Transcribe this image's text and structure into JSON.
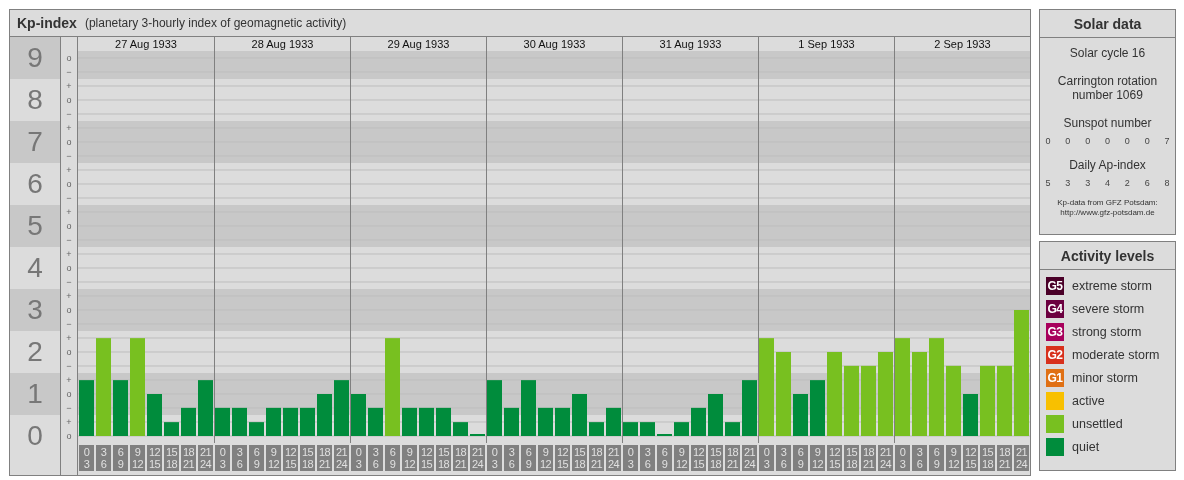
{
  "kp_panel": {
    "title": "Kp-index",
    "subtitle": "(planetary 3-hourly index of geomagnetic activity)",
    "scale": [
      {
        "marks": [
          "o",
          "−"
        ]
      },
      {
        "marks": [
          "+",
          "o",
          "−"
        ]
      },
      {
        "marks": [
          "+",
          "o",
          "−"
        ]
      },
      {
        "marks": [
          "+",
          "o",
          "−"
        ]
      },
      {
        "marks": [
          "+",
          "o",
          "−"
        ]
      },
      {
        "marks": [
          "+",
          "o",
          "−"
        ]
      },
      {
        "marks": [
          "+",
          "o",
          "−"
        ]
      },
      {
        "marks": [
          "+",
          "o",
          "−"
        ]
      },
      {
        "marks": [
          "+",
          "o",
          "−"
        ]
      },
      {
        "marks": [
          "+",
          "o"
        ]
      }
    ],
    "days": [
      {
        "date": "27 Aug 1933"
      },
      {
        "date": "28 Aug 1933"
      },
      {
        "date": "29 Aug 1933"
      },
      {
        "date": "30 Aug 1933"
      },
      {
        "date": "31 Aug 1933"
      },
      {
        "date": "1 Sep 1933"
      },
      {
        "date": "2 Sep 1933"
      }
    ],
    "chart_data": {
      "type": "bar",
      "stacked": true,
      "grid": true,
      "ylim": [
        0,
        9
      ],
      "yticks": [
        9,
        8,
        7,
        6,
        5,
        4,
        3,
        2,
        1,
        0
      ],
      "categories": [
        "0 3",
        "3 6",
        "6 9",
        "9 12",
        "12 15",
        "15 18",
        "18 21",
        "21 24",
        "0 3",
        "3 6",
        "6 9",
        "9 12",
        "12 15",
        "15 18",
        "18 21",
        "21 24",
        "0 3",
        "3 6",
        "6 9",
        "9 12",
        "12 15",
        "15 18",
        "18 21",
        "21 24",
        "0 3",
        "3 6",
        "6 9",
        "9 12",
        "12 15",
        "15 18",
        "18 21",
        "21 24",
        "0 3",
        "3 6",
        "6 9",
        "9 12",
        "12 15",
        "15 18",
        "18 21",
        "21 24",
        "0 3",
        "3 6",
        "6 9",
        "9 12",
        "12 15",
        "15 18",
        "18 21",
        "21 24",
        "0 3",
        "3 6",
        "6 9",
        "9 12",
        "12 15",
        "15 18",
        "18 21",
        "21 24"
      ],
      "series": [
        {
          "color": "#008c3c",
          "values": [
            1.33,
            null,
            1.33,
            null,
            1,
            0.33,
            0.67,
            1.33,
            0.67,
            0.67,
            0.33,
            0.67,
            0.67,
            0.67,
            1,
            1.33,
            1,
            0.67,
            null,
            0.67,
            0.67,
            0.67,
            0.33,
            0,
            1.33,
            0.67,
            1.33,
            0.67,
            0.67,
            1,
            0.33,
            0.67,
            0.33,
            0.33,
            0,
            0.33,
            0.67,
            1,
            0.33,
            1.33,
            null,
            null,
            1,
            1.33,
            null,
            null,
            null,
            null,
            null,
            null,
            null,
            null,
            1,
            null,
            null,
            null
          ]
        },
        {
          "color": "#78c020",
          "values": [
            null,
            2.33,
            null,
            2.33,
            null,
            null,
            null,
            null,
            null,
            null,
            null,
            null,
            null,
            null,
            null,
            null,
            null,
            null,
            2.33,
            null,
            null,
            null,
            null,
            null,
            null,
            null,
            null,
            null,
            null,
            null,
            null,
            null,
            null,
            null,
            null,
            null,
            null,
            null,
            null,
            null,
            2.33,
            2,
            null,
            null,
            2,
            1.67,
            1.67,
            2,
            2.33,
            2,
            2.33,
            1.67,
            null,
            1.67,
            1.67,
            3
          ]
        }
      ]
    }
  },
  "solar_data": {
    "title": "Solar data",
    "solar_cycle": "Solar cycle 16",
    "carrington": "Carrington rotation number 1069",
    "sunspot_label": "Sunspot number",
    "sunspot_values": [
      "0",
      "0",
      "0",
      "0",
      "0",
      "0",
      "7"
    ],
    "ap_label": "Daily Ap-index",
    "ap_values": [
      "5",
      "3",
      "3",
      "4",
      "2",
      "6",
      "8"
    ],
    "source": "Kp-data from GFZ Potsdam:",
    "source_url": "http://www.gfz-potsdam.de"
  },
  "activity_levels": {
    "title": "Activity levels",
    "items": [
      {
        "badge": "G5",
        "label": "extreme storm",
        "color": "#4a0028"
      },
      {
        "badge": "G4",
        "label": "severe storm",
        "color": "#6c0040"
      },
      {
        "badge": "G3",
        "label": "strong storm",
        "color": "#a8005c"
      },
      {
        "badge": "G2",
        "label": "moderate storm",
        "color": "#d8301c"
      },
      {
        "badge": "G1",
        "label": "minor storm",
        "color": "#e07014"
      },
      {
        "label": "active",
        "color": "#f8c000"
      },
      {
        "label": "unsettled",
        "color": "#78c020"
      },
      {
        "label": "quiet",
        "color": "#008c3c"
      }
    ]
  }
}
